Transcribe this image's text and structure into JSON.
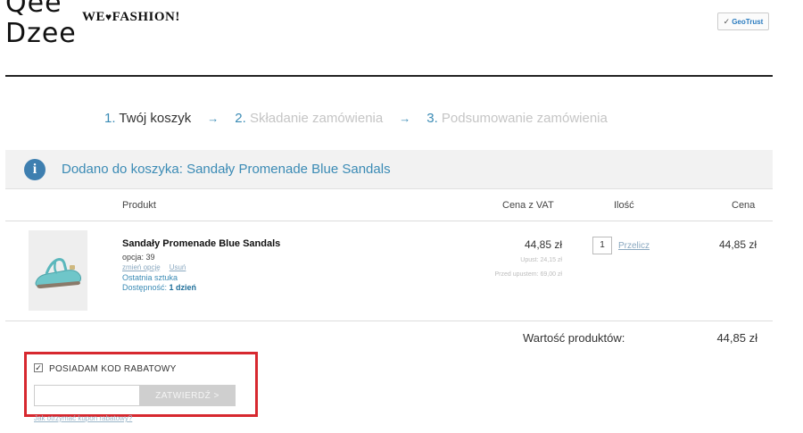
{
  "header": {
    "logo_line1": "Qee",
    "logo_line2": "Dzee",
    "tagline_pre": "WE",
    "tagline_post": "FASHION!",
    "trust_badge": "GeoTrust"
  },
  "steps": [
    {
      "num": "1.",
      "label": "Twój koszyk",
      "active": true
    },
    {
      "num": "2.",
      "label": "Składanie zamówienia",
      "active": false
    },
    {
      "num": "3.",
      "label": "Podsumowanie zamówienia",
      "active": false
    }
  ],
  "step_arrow": "→",
  "info": {
    "icon": "info-icon",
    "message": "Dodano do koszyka: Sandały Promenade Blue Sandals"
  },
  "table": {
    "headers": {
      "product": "Produkt",
      "price_vat": "Cena z VAT",
      "quantity": "Ilość",
      "price": "Cena"
    },
    "item": {
      "name": "Sandały Promenade Blue Sandals",
      "option": "opcja: 39",
      "change_option": "zmień opcję",
      "remove": "Usuń",
      "last_piece": "Ostatnia sztuka",
      "availability_label": "Dostępność:",
      "availability_value": "1 dzień",
      "price_vat": "44,85 zł",
      "savings": "Upust: 24,15 zł",
      "price_before": "Przed upustem: 69,00 zł",
      "quantity": "1",
      "recalculate": "Przelicz",
      "total": "44,85 zł"
    }
  },
  "summary": {
    "label": "Wartość produktów:",
    "value": "44,85 zł"
  },
  "coupon": {
    "checkbox_checked": true,
    "label": "POSIADAM KOD RABATOWY",
    "input_value": "",
    "submit": "ZATWIERDŹ >",
    "info_link": "Jak otrzymać kupon rabatowy?"
  },
  "colors": {
    "accent": "#3b8bb5",
    "highlight_border": "#d7282f",
    "info_icon": "#3e7fb0"
  }
}
